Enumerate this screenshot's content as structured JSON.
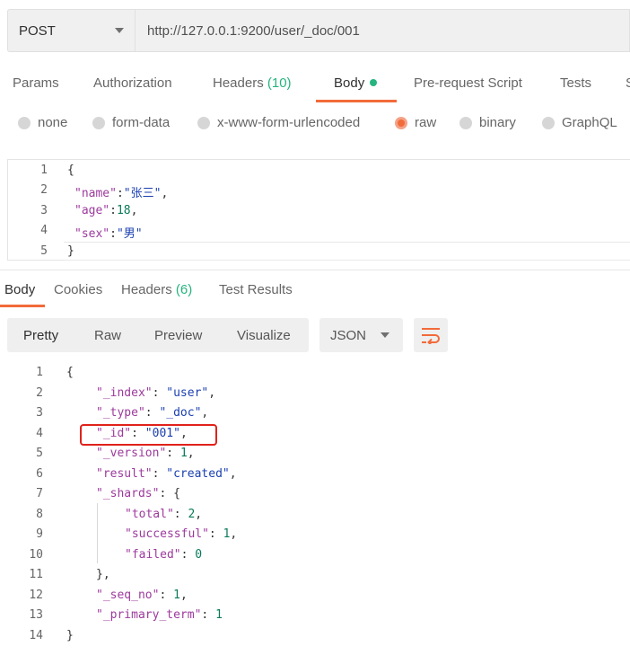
{
  "request": {
    "method": "POST",
    "url": "http://127.0.0.1:9200/user/_doc/001"
  },
  "request_tabs": {
    "params": "Params",
    "authorization": "Authorization",
    "headers": "Headers",
    "headers_count": "(10)",
    "body": "Body",
    "pre_request": "Pre-request Script",
    "tests": "Tests",
    "overflow": "S"
  },
  "body_types": {
    "none": "none",
    "form_data": "form-data",
    "urlencoded": "x-www-form-urlencoded",
    "raw": "raw",
    "binary": "binary",
    "graphql": "GraphQL"
  },
  "request_body": {
    "line_numbers": [
      "1",
      "2",
      "3",
      "4",
      "5"
    ],
    "open_brace": "{",
    "close_brace": "}",
    "fields": [
      {
        "key": "\"name\"",
        "value": "\"张三\"",
        "tail": ","
      },
      {
        "key": "\"age\"",
        "value": "18",
        "tail": ","
      },
      {
        "key": "\"sex\"",
        "value": "\"男\"",
        "tail": ""
      }
    ]
  },
  "response_tabs": {
    "body": "Body",
    "cookies": "Cookies",
    "headers": "Headers",
    "headers_count": "(6)",
    "test_results": "Test Results"
  },
  "view_modes": {
    "pretty": "Pretty",
    "raw": "Raw",
    "preview": "Preview",
    "visualize": "Visualize"
  },
  "format": "JSON",
  "response_body": {
    "line_numbers": [
      "1",
      "2",
      "3",
      "4",
      "5",
      "6",
      "7",
      "8",
      "9",
      "10",
      "11",
      "12",
      "13",
      "14"
    ],
    "open_brace": "{",
    "close_brace": "}",
    "index_key": "\"_index\"",
    "index_val": "\"user\"",
    "type_key": "\"_type\"",
    "type_val": "\"_doc\"",
    "id_key": "\"_id\"",
    "id_val": "\"001\"",
    "version_key": "\"_version\"",
    "version_val": "1",
    "result_key": "\"result\"",
    "result_val": "\"created\"",
    "shards_key": "\"_shards\"",
    "shards_open": "{",
    "total_key": "\"total\"",
    "total_val": "2",
    "successful_key": "\"successful\"",
    "successful_val": "1",
    "failed_key": "\"failed\"",
    "failed_val": "0",
    "shards_close": "},",
    "seq_key": "\"_seq_no\"",
    "seq_val": "1",
    "primary_key": "\"_primary_term\"",
    "primary_val": "1"
  },
  "colors": {
    "accent": "#f26b3a",
    "success": "#26b47f",
    "highlight": "#e0221b"
  }
}
